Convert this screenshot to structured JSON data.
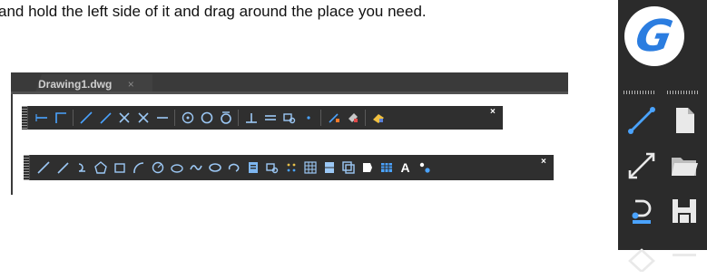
{
  "caption": "and hold the left side of it and drag around the place you need.",
  "drawing": {
    "tab_label": "Drawing1.dwg",
    "tab_close": "×"
  },
  "toolbar_top": {
    "close": "×",
    "icons": [
      "extend-line-icon",
      "corner-line-icon",
      "separator",
      "line-icon",
      "ray-icon",
      "cross-x-icon",
      "cross-x-alt-icon",
      "dash-line-icon",
      "separator",
      "circle-center-icon",
      "circle-icon",
      "circle-tangent-icon",
      "separator",
      "perpendicular-icon",
      "parallel-icon",
      "snap-box-icon",
      "dot-icon",
      "separator",
      "snap-settings-icon",
      "magnet-icon",
      "separator",
      "eraser-icon"
    ]
  },
  "toolbar_bottom": {
    "close": "×",
    "text_tool": "A",
    "icons": [
      "line-icon",
      "construction-line-icon",
      "polyline-arc-icon",
      "polygon-icon",
      "rectangle-icon",
      "arc-icon",
      "circle-icon",
      "ellipse-icon",
      "spline-icon",
      "ellipse-filled-icon",
      "ellipse-arc-icon",
      "insert-block-icon",
      "create-block-icon",
      "point-icon",
      "hatch-icon",
      "gradient-icon",
      "region-icon",
      "table-shape-icon",
      "table-icon",
      "text-icon",
      "add-selected-icon"
    ]
  },
  "right_panel": {
    "logo": "G",
    "left_column": [
      "line-tool-icon",
      "construction-line-tool-icon",
      "polyline-tool-icon",
      "polygon-tool-icon"
    ],
    "right_column": [
      "new-file-icon",
      "open-folder-icon",
      "save-icon",
      "minus-icon"
    ]
  },
  "colors": {
    "toolbar_bg": "#2f2f2f",
    "tab_bg": "#3a3a3a",
    "accent_blue": "#3d8ee8",
    "logo_blue": "#2b7de0"
  }
}
